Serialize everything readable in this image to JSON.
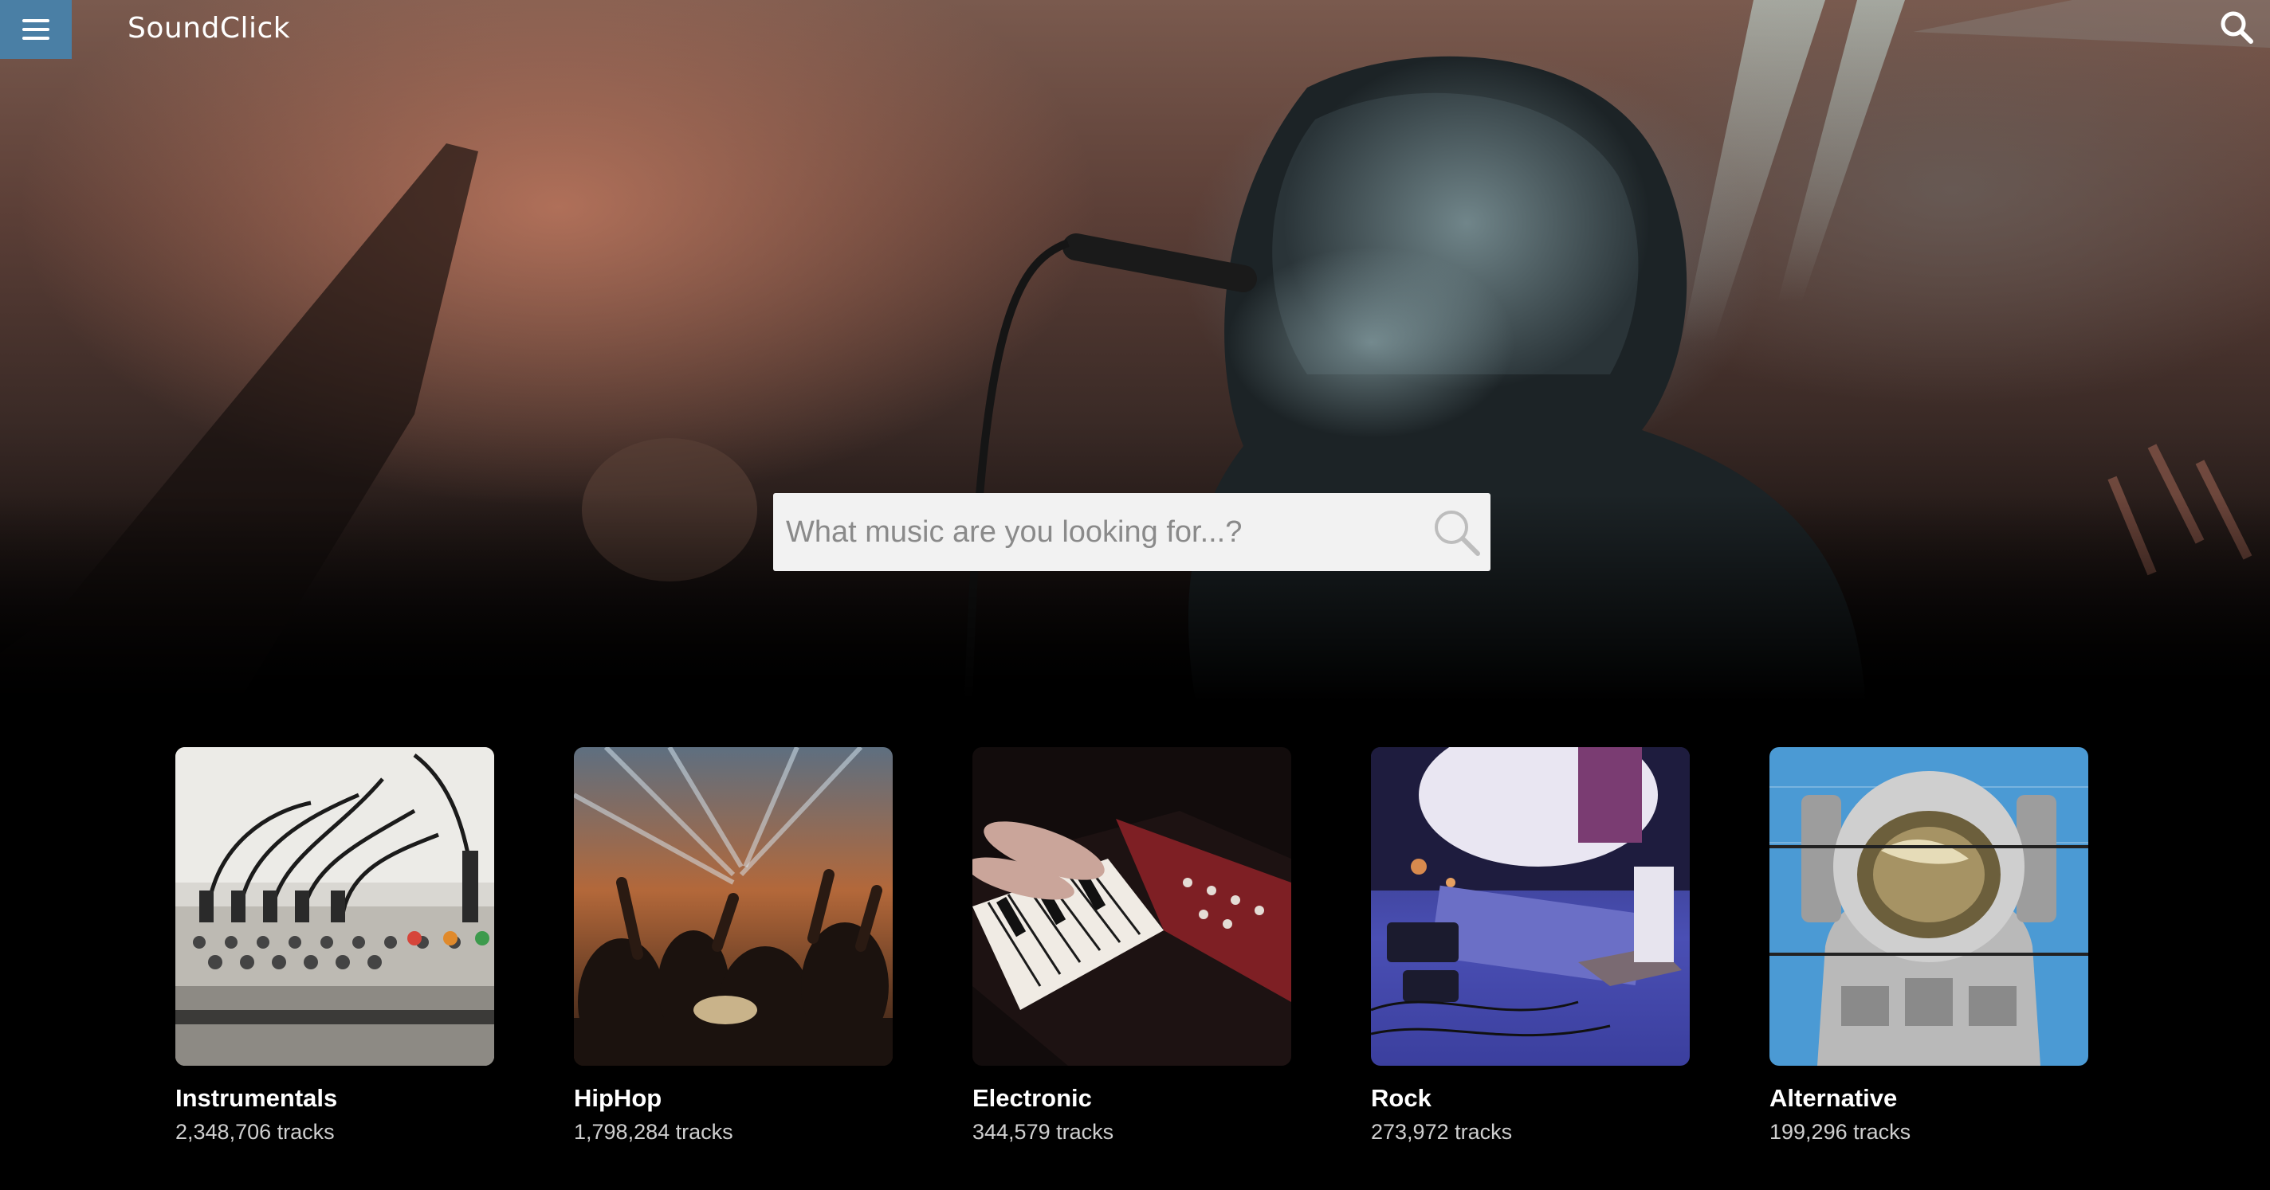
{
  "app": {
    "logo_text": "SoundClick",
    "menu_icon": "hamburger-menu-icon",
    "top_search_icon": "search-icon",
    "accent_color": "#4a7fa5"
  },
  "search": {
    "placeholder": "What music are you looking for...?",
    "value": "",
    "icon": "search-icon"
  },
  "genres": [
    {
      "name": "Instrumentals",
      "tracks": "2,348,706 tracks",
      "image": "mixing-console-image"
    },
    {
      "name": "HipHop",
      "tracks": "1,798,284 tracks",
      "image": "concert-crowd-image"
    },
    {
      "name": "Electronic",
      "tracks": "344,579 tracks",
      "image": "synth-keyboard-image"
    },
    {
      "name": "Rock",
      "tracks": "273,972 tracks",
      "image": "stage-pedals-image"
    },
    {
      "name": "Alternative",
      "tracks": "199,296 tracks",
      "image": "astronaut-art-image"
    }
  ]
}
